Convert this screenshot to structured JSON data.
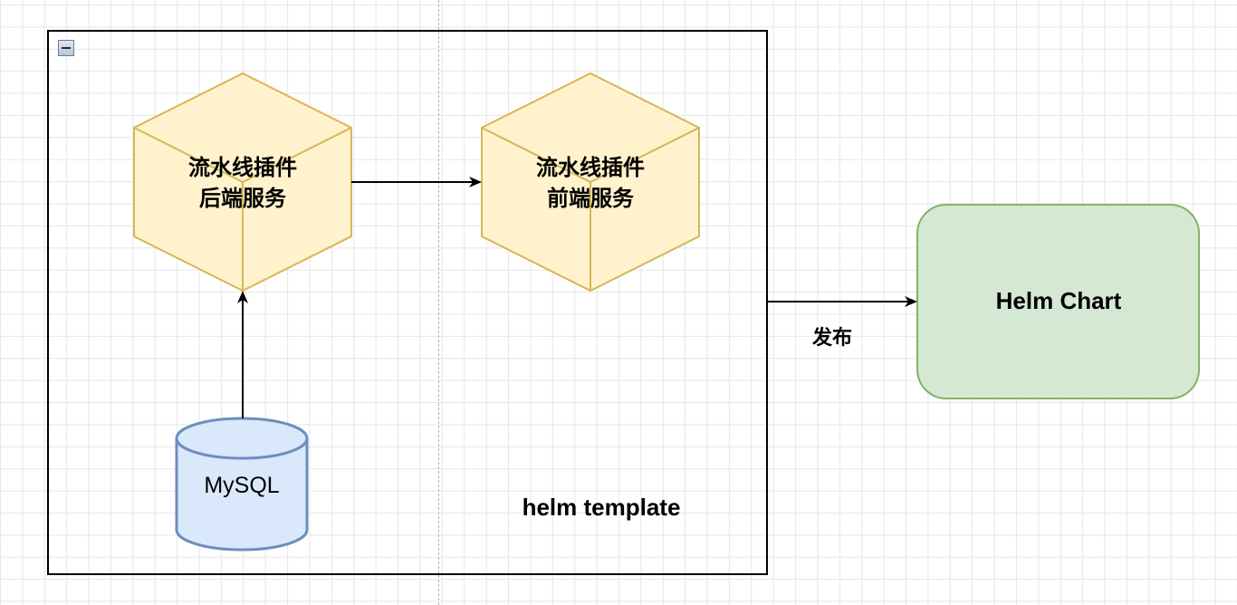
{
  "diagram": {
    "nodes": {
      "backend_service": {
        "label": "流水线插件\n后端服务",
        "shape": "cube",
        "fill": "#fff2cc",
        "stroke": "#d6b656"
      },
      "frontend_service": {
        "label": "流水线插件\n前端服务",
        "shape": "cube",
        "fill": "#fff2cc",
        "stroke": "#d6b656"
      },
      "mysql": {
        "label": "MySQL",
        "shape": "cylinder",
        "fill": "#dae8fc",
        "stroke": "#6c8ebf"
      },
      "helm_chart": {
        "label": "Helm Chart",
        "shape": "rounded-rectangle",
        "fill": "#d5e8d4",
        "stroke": "#82b366"
      },
      "template_group": {
        "label": "helm template",
        "shape": "container"
      }
    },
    "edges": [
      {
        "from": "mysql",
        "to": "backend_service",
        "label": ""
      },
      {
        "from": "backend_service",
        "to": "frontend_service",
        "label": ""
      },
      {
        "from": "template_group",
        "to": "helm_chart",
        "label": "发布"
      }
    ]
  }
}
